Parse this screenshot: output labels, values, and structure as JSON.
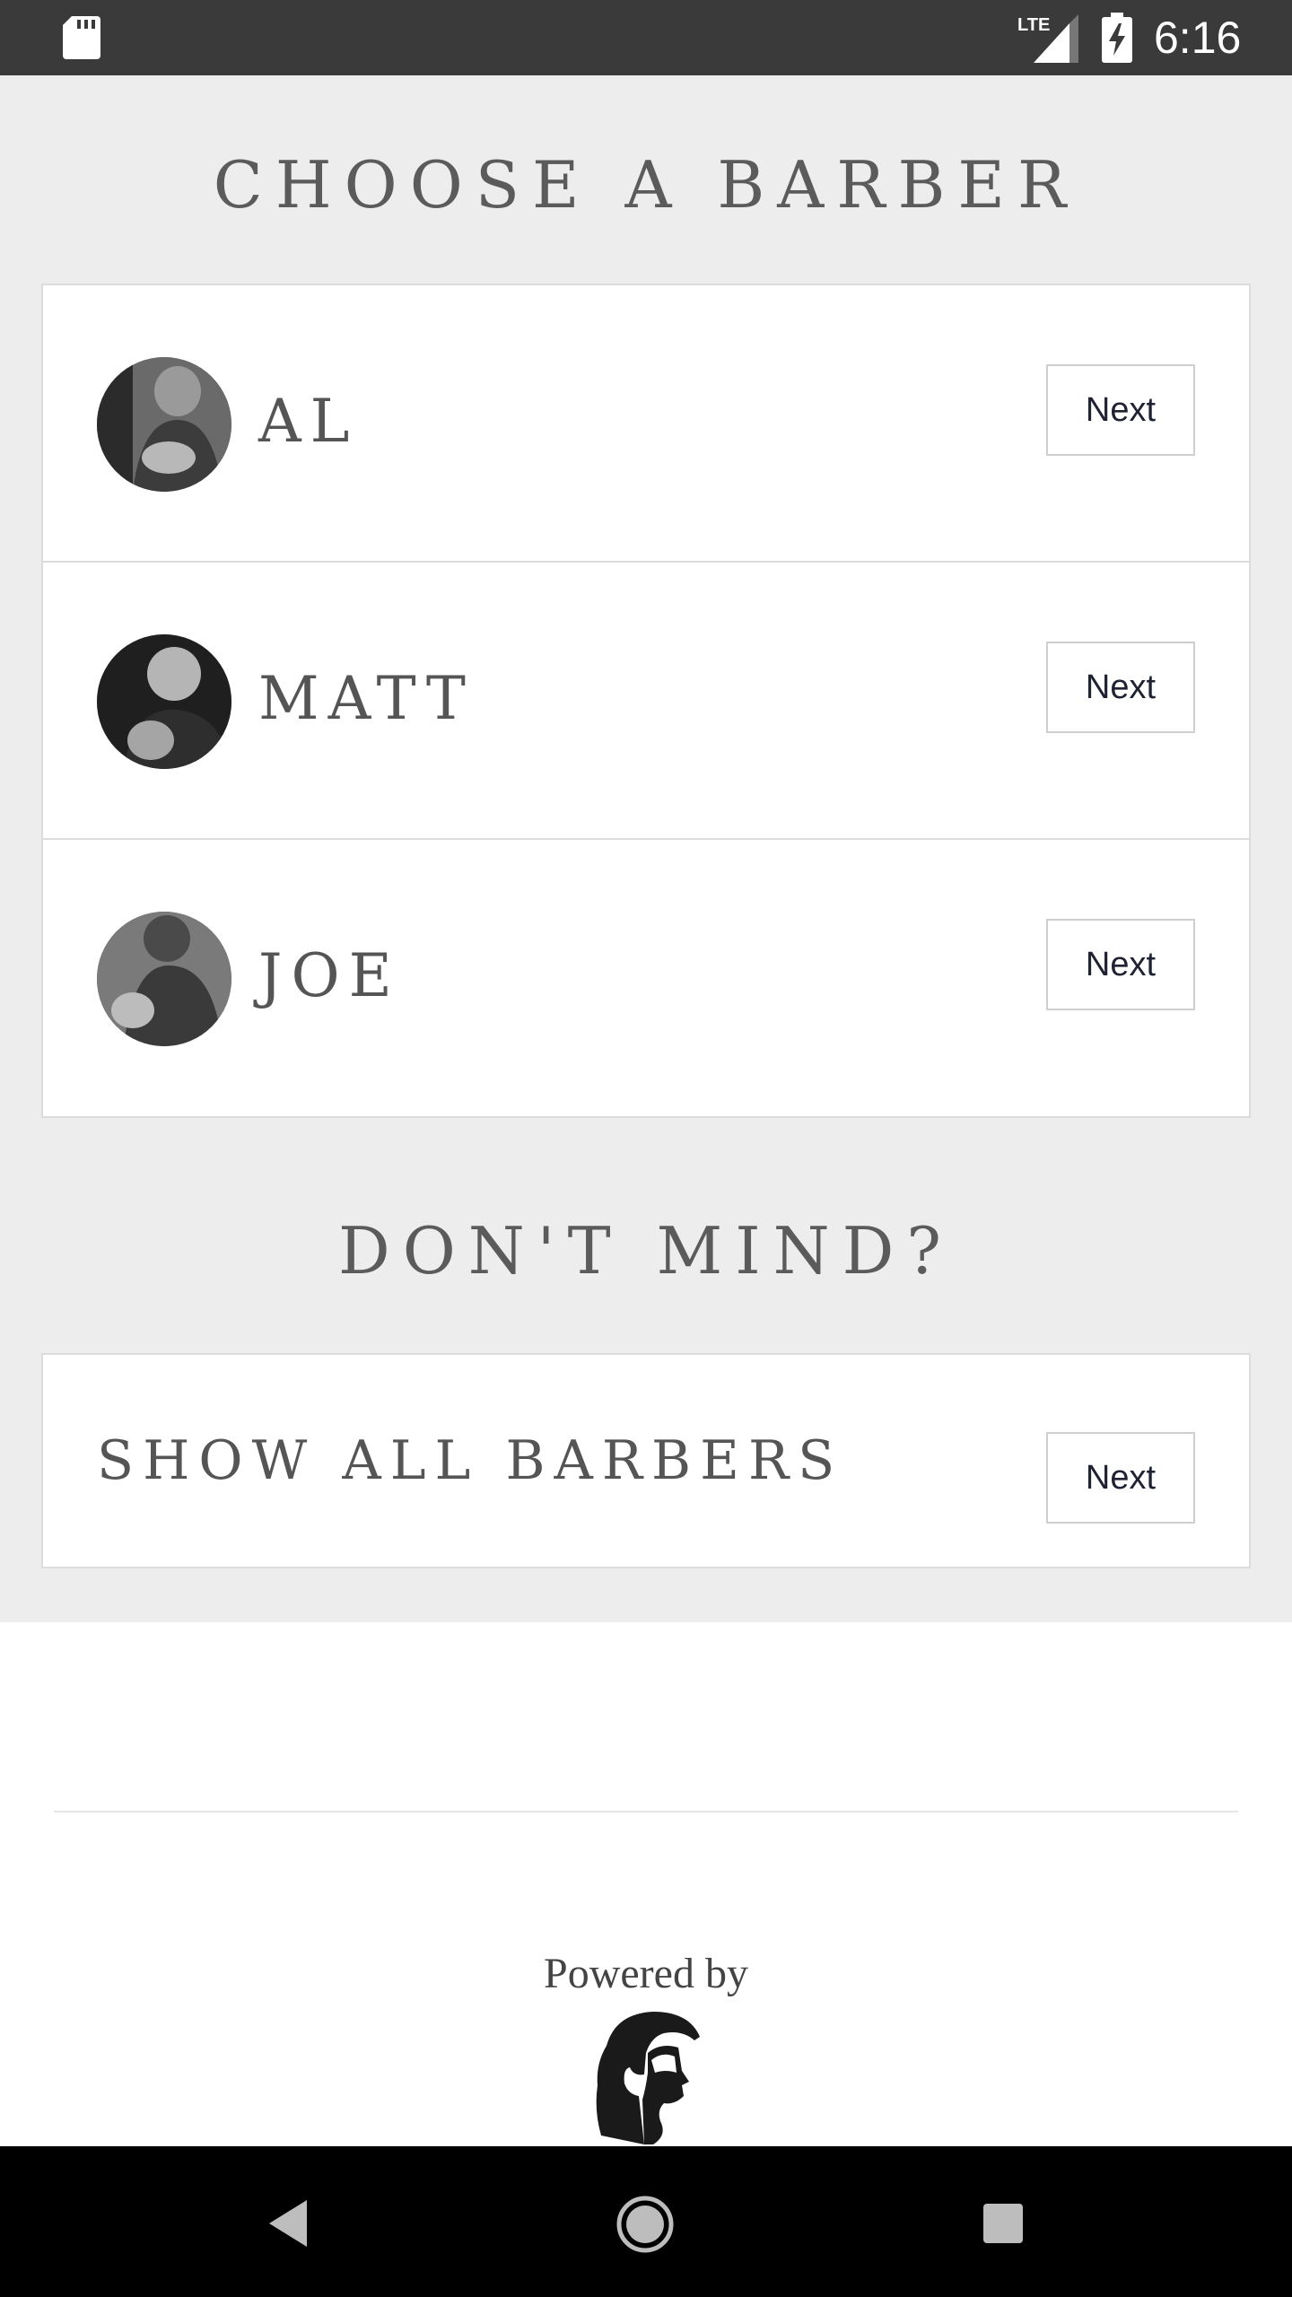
{
  "status_bar": {
    "time": "6:16",
    "network": "LTE",
    "icons": [
      "sd-card-icon",
      "lte-signal-icon",
      "battery-charging-icon"
    ]
  },
  "headings": {
    "choose": "CHOOSE A BARBER",
    "dont_mind": "DON'T MIND?"
  },
  "barbers": [
    {
      "name": "AL",
      "button_label": "Next"
    },
    {
      "name": "MATT",
      "button_label": "Next"
    },
    {
      "name": "JOE",
      "button_label": "Next"
    }
  ],
  "show_all": {
    "label": "SHOW ALL BARBERS",
    "button_label": "Next"
  },
  "footer": {
    "powered_by": "Powered by",
    "logo": "bearded-man-logo-icon"
  },
  "nav_bar": {
    "buttons": [
      "back",
      "home",
      "recents"
    ]
  }
}
